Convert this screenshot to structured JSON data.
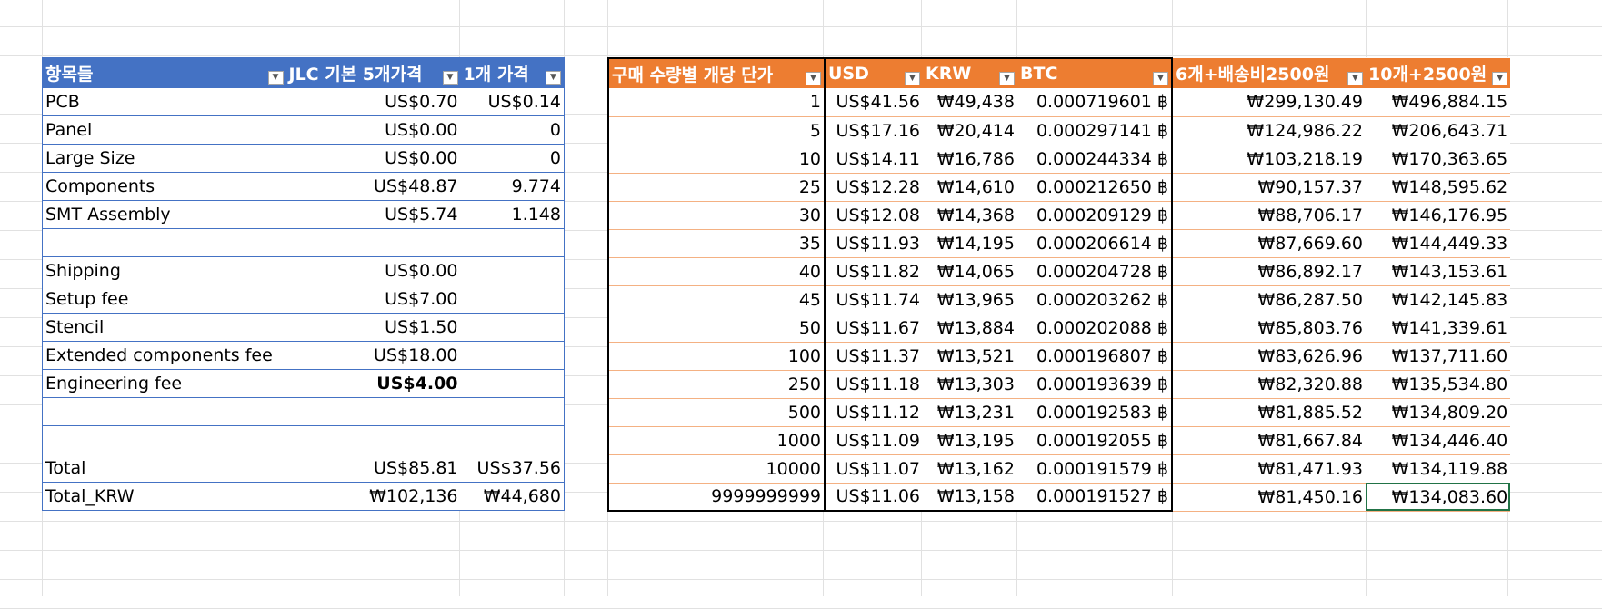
{
  "left_table": {
    "headers": [
      "항목들",
      "JLC 기본 5개가격",
      "1개 가격"
    ],
    "rows": [
      {
        "item": "PCB",
        "price5": "US$0.70",
        "price1": "US$0.14"
      },
      {
        "item": "Panel",
        "price5": "US$0.00",
        "price1": "0"
      },
      {
        "item": "Large Size",
        "price5": "US$0.00",
        "price1": "0"
      },
      {
        "item": "Components",
        "price5": "US$48.87",
        "price1": "9.774"
      },
      {
        "item": "SMT Assembly",
        "price5": "US$5.74",
        "price1": "1.148"
      },
      {
        "item": "",
        "price5": "",
        "price1": ""
      },
      {
        "item": "Shipping",
        "price5": "US$0.00",
        "price1": ""
      },
      {
        "item": "Setup fee",
        "price5": "US$7.00",
        "price1": ""
      },
      {
        "item": "Stencil",
        "price5": "US$1.50",
        "price1": ""
      },
      {
        "item": "Extended components fee",
        "price5": "US$18.00",
        "price1": ""
      },
      {
        "item": "Engineering fee",
        "price5": "US$4.00",
        "price1": "",
        "bold_price5": true
      },
      {
        "item": "",
        "price5": "",
        "price1": ""
      },
      {
        "item": "",
        "price5": "",
        "price1": ""
      },
      {
        "item": "Total",
        "price5": "US$85.81",
        "price1": "US$37.56"
      },
      {
        "item": "Total_KRW",
        "price5": "₩102,136",
        "price1": "₩44,680"
      }
    ]
  },
  "right_table": {
    "headers": [
      "구매 수량별 개당 단가",
      "USD",
      "KRW",
      "BTC",
      "6개+배송비2500원",
      "10개+2500원"
    ],
    "btc_symbol": "฿",
    "rows": [
      {
        "qty": "1",
        "usd": "US$41.56",
        "krw": "₩49,438",
        "btc": "0.000719601",
        "p6": "₩299,130.49",
        "p10": "₩496,884.15"
      },
      {
        "qty": "5",
        "usd": "US$17.16",
        "krw": "₩20,414",
        "btc": "0.000297141",
        "p6": "₩124,986.22",
        "p10": "₩206,643.71"
      },
      {
        "qty": "10",
        "usd": "US$14.11",
        "krw": "₩16,786",
        "btc": "0.000244334",
        "p6": "₩103,218.19",
        "p10": "₩170,363.65"
      },
      {
        "qty": "25",
        "usd": "US$12.28",
        "krw": "₩14,610",
        "btc": "0.000212650",
        "p6": "₩90,157.37",
        "p10": "₩148,595.62"
      },
      {
        "qty": "30",
        "usd": "US$12.08",
        "krw": "₩14,368",
        "btc": "0.000209129",
        "p6": "₩88,706.17",
        "p10": "₩146,176.95"
      },
      {
        "qty": "35",
        "usd": "US$11.93",
        "krw": "₩14,195",
        "btc": "0.000206614",
        "p6": "₩87,669.60",
        "p10": "₩144,449.33"
      },
      {
        "qty": "40",
        "usd": "US$11.82",
        "krw": "₩14,065",
        "btc": "0.000204728",
        "p6": "₩86,892.17",
        "p10": "₩143,153.61"
      },
      {
        "qty": "45",
        "usd": "US$11.74",
        "krw": "₩13,965",
        "btc": "0.000203262",
        "p6": "₩86,287.50",
        "p10": "₩142,145.83"
      },
      {
        "qty": "50",
        "usd": "US$11.67",
        "krw": "₩13,884",
        "btc": "0.000202088",
        "p6": "₩85,803.76",
        "p10": "₩141,339.61"
      },
      {
        "qty": "100",
        "usd": "US$11.37",
        "krw": "₩13,521",
        "btc": "0.000196807",
        "p6": "₩83,626.96",
        "p10": "₩137,711.60"
      },
      {
        "qty": "250",
        "usd": "US$11.18",
        "krw": "₩13,303",
        "btc": "0.000193639",
        "p6": "₩82,320.88",
        "p10": "₩135,534.80"
      },
      {
        "qty": "500",
        "usd": "US$11.12",
        "krw": "₩13,231",
        "btc": "0.000192583",
        "p6": "₩81,885.52",
        "p10": "₩134,809.20"
      },
      {
        "qty": "1000",
        "usd": "US$11.09",
        "krw": "₩13,195",
        "btc": "0.000192055",
        "p6": "₩81,667.84",
        "p10": "₩134,446.40"
      },
      {
        "qty": "10000",
        "usd": "US$11.07",
        "krw": "₩13,162",
        "btc": "0.000191579",
        "p6": "₩81,471.93",
        "p10": "₩134,119.88"
      },
      {
        "qty": "9999999999",
        "usd": "US$11.06",
        "krw": "₩13,158",
        "btc": "0.000191527",
        "p6": "₩81,450.16",
        "p10": "₩134,083.60"
      }
    ]
  },
  "colors": {
    "left_header": "#4472c4",
    "right_header": "#ed7d31",
    "selection": "#217346",
    "gridline": "#e1e1e1"
  },
  "icons": {
    "filter": "filter-dropdown-icon"
  }
}
